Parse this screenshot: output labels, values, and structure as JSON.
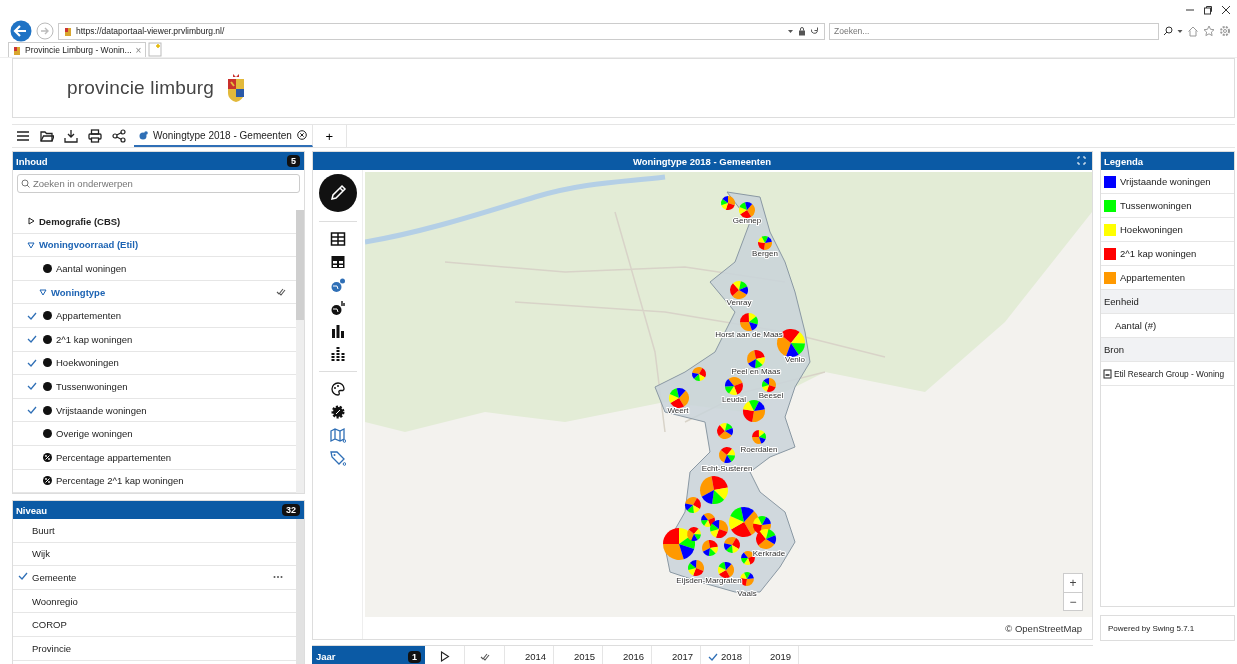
{
  "browser": {
    "url": "https://dataportaal-viewer.prvlimburg.nl/",
    "search_placeholder": "Zoeken...",
    "tab": {
      "title": "Provincie Limburg - Wonin...",
      "close": "×"
    }
  },
  "header": {
    "logo_text": "provincie limburg"
  },
  "toolbar": {
    "tabs": [
      {
        "label": "Woningtype 2018 - Gemeenten",
        "selected": true
      }
    ],
    "add": "+"
  },
  "content_panel": {
    "title": "Inhoud",
    "count": "5",
    "search_placeholder": "Zoeken in onderwerpen",
    "tree": [
      {
        "label": "Demografie (CBS)",
        "kind": "group",
        "expanded": false
      },
      {
        "label": "Woningvoorraad (Etil)",
        "kind": "group",
        "expanded": true,
        "children": [
          {
            "label": "Aantal woningen",
            "kind": "layer",
            "checked": false
          },
          {
            "label": "Woningtype",
            "kind": "group",
            "expanded": true,
            "children": [
              {
                "label": "Appartementen",
                "kind": "layer",
                "checked": true
              },
              {
                "label": "2^1 kap woningen",
                "kind": "layer",
                "checked": true
              },
              {
                "label": "Hoekwoningen",
                "kind": "layer",
                "checked": true
              },
              {
                "label": "Tussenwoningen",
                "kind": "layer",
                "checked": true
              },
              {
                "label": "Vrijstaande woningen",
                "kind": "layer",
                "checked": true
              },
              {
                "label": "Overige woningen",
                "kind": "layer",
                "checked": false
              },
              {
                "label": "Percentage appartementen",
                "kind": "percent",
                "checked": false
              },
              {
                "label": "Percentage 2^1 kap woningen",
                "kind": "percent",
                "checked": false
              }
            ]
          }
        ]
      }
    ]
  },
  "level_panel": {
    "title": "Niveau",
    "count": "32",
    "items": [
      {
        "label": "Buurt",
        "selected": false
      },
      {
        "label": "Wijk",
        "selected": false
      },
      {
        "label": "Gemeente",
        "selected": true
      },
      {
        "label": "Woonregio",
        "selected": false
      },
      {
        "label": "COROP",
        "selected": false
      },
      {
        "label": "Provincie",
        "selected": false
      }
    ]
  },
  "map": {
    "title": "Woningtype 2018 - Gemeenten",
    "labels": [
      "Gennep",
      "Bergen",
      "Venray",
      "Horst aan de Maas",
      "Venlo",
      "Peel en Maas",
      "Leudal",
      "Beesel",
      "Weert",
      "Roerdalen",
      "Echt-Susteren",
      "Kerkrade",
      "Eijsden-Margraten",
      "Vaals"
    ],
    "attribution": "© OpenStreetMap",
    "zoom_in": "+",
    "zoom_out": "−"
  },
  "year_bar": {
    "title": "Jaar",
    "count": "1",
    "years": [
      {
        "label": "2014",
        "selected": false
      },
      {
        "label": "2015",
        "selected": false
      },
      {
        "label": "2016",
        "selected": false
      },
      {
        "label": "2017",
        "selected": false
      },
      {
        "label": "2018",
        "selected": true
      },
      {
        "label": "2019",
        "selected": false
      }
    ]
  },
  "legend": {
    "title": "Legenda",
    "items": [
      {
        "label": "Vrijstaande woningen",
        "color": "#0000ff"
      },
      {
        "label": "Tussenwoningen",
        "color": "#00ff00"
      },
      {
        "label": "Hoekwoningen",
        "color": "#ffff00"
      },
      {
        "label": "2^1 kap woningen",
        "color": "#ff0000"
      },
      {
        "label": "Appartementen",
        "color": "#ff9900"
      }
    ],
    "unit_title": "Eenheid",
    "unit": "Aantal (#)",
    "source_title": "Bron",
    "source": "Etil Research Group - Woning",
    "footer": "Powered by Swing 5.7.1"
  }
}
